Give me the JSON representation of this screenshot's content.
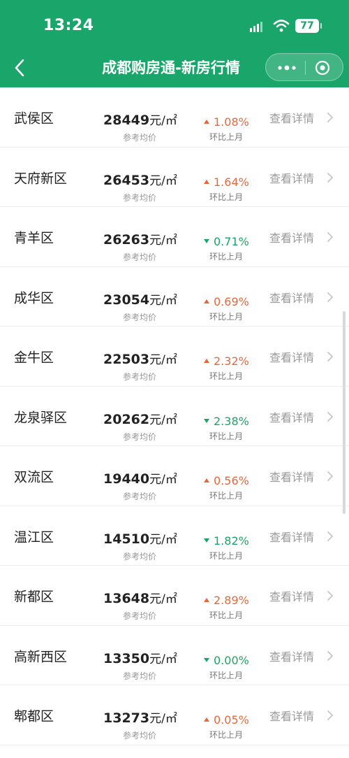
{
  "status": {
    "time": "13:24",
    "battery": "77"
  },
  "header": {
    "title": "成都购房通-新房行情"
  },
  "labels": {
    "price_sub": "参考均价",
    "change_sub": "环比上月",
    "detail": "查看详情",
    "unit": "元/㎡"
  },
  "rows": [
    {
      "district": "武侯区",
      "price": "28449",
      "change": "1.08%",
      "direction": "up"
    },
    {
      "district": "天府新区",
      "price": "26453",
      "change": "1.64%",
      "direction": "up"
    },
    {
      "district": "青羊区",
      "price": "26263",
      "change": "0.71%",
      "direction": "down"
    },
    {
      "district": "成华区",
      "price": "23054",
      "change": "0.69%",
      "direction": "up"
    },
    {
      "district": "金牛区",
      "price": "22503",
      "change": "2.32%",
      "direction": "up"
    },
    {
      "district": "龙泉驿区",
      "price": "20262",
      "change": "2.38%",
      "direction": "down"
    },
    {
      "district": "双流区",
      "price": "19440",
      "change": "0.56%",
      "direction": "up"
    },
    {
      "district": "温江区",
      "price": "14510",
      "change": "1.82%",
      "direction": "down"
    },
    {
      "district": "新都区",
      "price": "13648",
      "change": "2.89%",
      "direction": "up"
    },
    {
      "district": "高新西区",
      "price": "13350",
      "change": "0.00%",
      "direction": "down"
    },
    {
      "district": "郫都区",
      "price": "13273",
      "change": "0.05%",
      "direction": "up"
    }
  ],
  "colors": {
    "brand": "#1aa56a",
    "up": "#e8673a",
    "down": "#1aa56a"
  }
}
